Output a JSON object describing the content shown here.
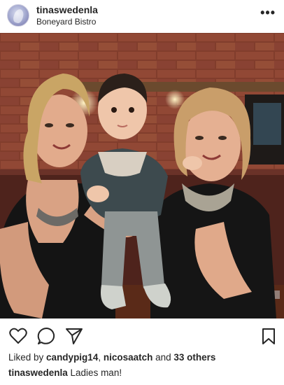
{
  "post": {
    "username": "tinaswedenla",
    "location": "Boneyard Bistro",
    "more_label": "•••"
  },
  "actions": {
    "like_icon": "heart-icon",
    "comment_icon": "comment-icon",
    "share_icon": "send-icon",
    "save_icon": "bookmark-icon"
  },
  "likes": {
    "prefix": "Liked by ",
    "user1": "candypig14",
    "separator": ", ",
    "user2": "nicosaatch",
    "suffix": " and ",
    "others": "33 others"
  },
  "caption": {
    "username": "tinaswedenla",
    "text": " Ladies man!"
  },
  "colors": {
    "text": "#262626",
    "brick": "#9a4a36",
    "booth": "#5a2a22"
  }
}
